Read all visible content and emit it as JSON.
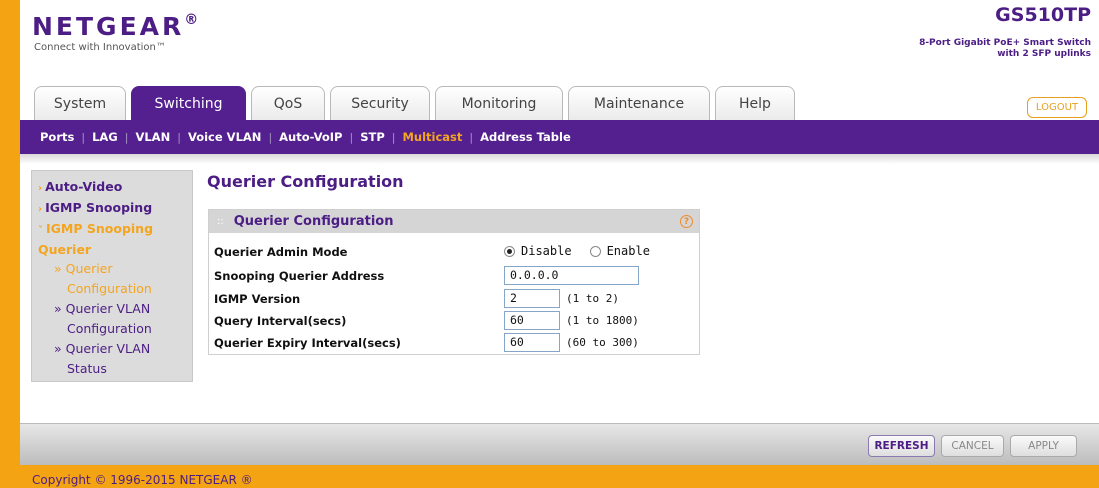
{
  "brand": {
    "logo_text": "NETGEAR",
    "logo_mark": "®",
    "tagline": "Connect with Innovation™",
    "model": "GS510TP",
    "model_desc_1": "8-Port Gigabit PoE+ Smart Switch",
    "model_desc_2": "with 2 SFP uplinks"
  },
  "tabs": [
    {
      "label": "System",
      "active": false
    },
    {
      "label": "Switching",
      "active": true
    },
    {
      "label": "QoS",
      "active": false
    },
    {
      "label": "Security",
      "active": false
    },
    {
      "label": "Monitoring",
      "active": false
    },
    {
      "label": "Maintenance",
      "active": false
    },
    {
      "label": "Help",
      "active": false
    }
  ],
  "logout_label": "LOGOUT",
  "subnav": [
    {
      "label": "Ports",
      "active": false
    },
    {
      "label": "LAG",
      "active": false
    },
    {
      "label": "VLAN",
      "active": false
    },
    {
      "label": "Voice VLAN",
      "active": false
    },
    {
      "label": "Auto-VoIP",
      "active": false
    },
    {
      "label": "STP",
      "active": false
    },
    {
      "label": "Multicast",
      "active": true
    },
    {
      "label": "Address Table",
      "active": false
    }
  ],
  "leftmenu": {
    "auto_video": "Auto-Video",
    "igmp_snooping": "IGMP Snooping",
    "igmp_snooping_querier_1": "IGMP Snooping",
    "igmp_snooping_querier_2": "Querier",
    "querier_config_1": "» Querier",
    "querier_config_2": "Configuration",
    "querier_vlan_config_1": "» Querier VLAN",
    "querier_vlan_config_2": "Configuration",
    "querier_vlan_status_1": "» Querier VLAN",
    "querier_vlan_status_2": "Status"
  },
  "page_title": "Querier Configuration",
  "panel": {
    "title": "Querier Configuration",
    "help_glyph": "?",
    "admin_mode_label": "Querier Admin Mode",
    "admin_mode_options": [
      "Disable",
      "Enable"
    ],
    "admin_mode_selected": "Disable",
    "address_label": "Snooping Querier Address",
    "address_value": "0.0.0.0",
    "igmp_version_label": "IGMP Version",
    "igmp_version_value": "2",
    "igmp_version_range": "(1 to 2)",
    "query_interval_label": "Query Interval(secs)",
    "query_interval_value": "60",
    "query_interval_range": "(1 to 1800)",
    "expiry_label": "Querier Expiry Interval(secs)",
    "expiry_value": "60",
    "expiry_range": "(60 to 300)"
  },
  "buttons": {
    "refresh": "REFRESH",
    "cancel": "CANCEL",
    "apply": "APPLY"
  },
  "copyright": "Copyright © 1996-2015 NETGEAR ®",
  "colors": {
    "brand_purple": "#4c1d84",
    "accent_orange": "#f4a412"
  }
}
